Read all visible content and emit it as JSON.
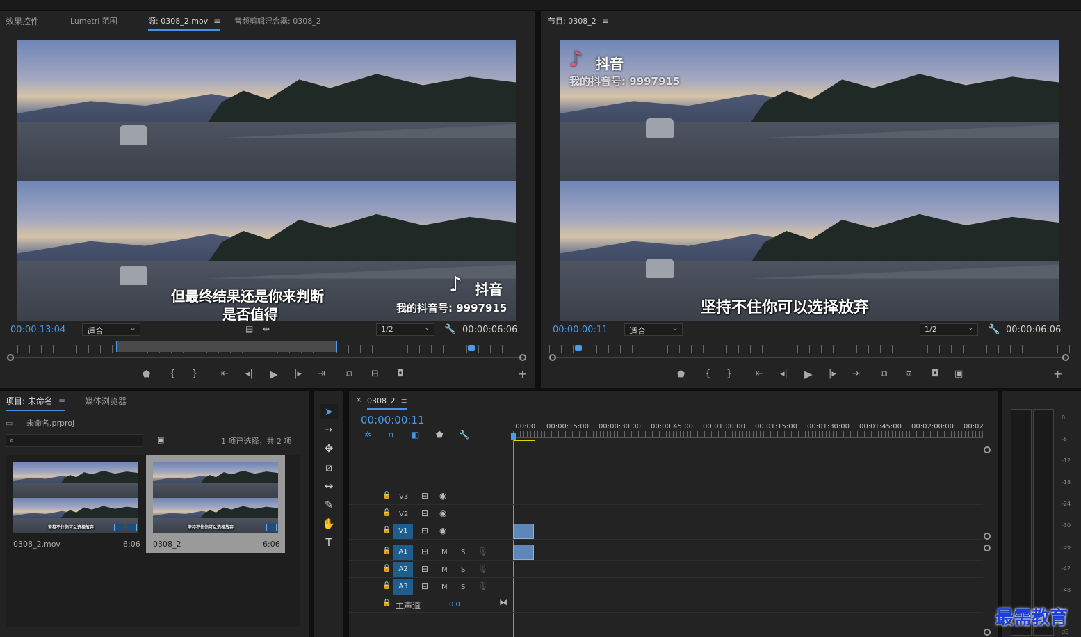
{
  "source_panel": {
    "tabs": [
      "效果控件",
      "Lumetri 范围",
      "源: 0308_2.mov",
      "音频剪辑混合器: 0308_2"
    ],
    "timecode": "00:00:13:04",
    "fit": "适合",
    "res": "1/2",
    "duration": "00:00:06:06",
    "subtitle_line1": "但最终结果还是你来判断",
    "subtitle_line2": "是否值得",
    "tiktok_name": "抖音",
    "tiktok_id": "我的抖音号: 9997915"
  },
  "program_panel": {
    "tab": "节目: 0308_2",
    "timecode": "00:00:00:11",
    "fit": "适合",
    "res": "1/2",
    "duration": "00:00:06:06",
    "tiktok_name": "抖音",
    "tiktok_id": "我的抖音号: 9997915",
    "subtitle": "坚持不住你可以选择放弃"
  },
  "project_panel": {
    "tabs": [
      "项目: 未命名",
      "媒体浏览器"
    ],
    "project_file": "未命名.prproj",
    "selection_info": "1 项已选择，共 2 项",
    "items": [
      {
        "name": "0308_2.mov",
        "duration": "6:06",
        "caption": "坚持不住你可以选择放弃"
      },
      {
        "name": "0308_2",
        "duration": "6:06",
        "caption": "坚持不住你可以选择放弃"
      }
    ]
  },
  "timeline": {
    "tab": "0308_2",
    "timecode": "00:00:00:11",
    "ruler": [
      ":00:00",
      "00:00:15:00",
      "00:00:30:00",
      "00:00:45:00",
      "00:01:00:00",
      "00:01:15:00",
      "00:01:30:00",
      "00:01:45:00",
      "00:02:00:00",
      "00:02"
    ],
    "video_tracks": [
      "V3",
      "V2",
      "V1"
    ],
    "audio_tracks": [
      "A1",
      "A2",
      "A3"
    ],
    "master_label": "主声道",
    "master_value": "0.0",
    "m": "M",
    "s": "S",
    "source_v": "V1",
    "source_a": "A1"
  },
  "meter": {
    "scale": [
      "0",
      "-6",
      "-12",
      "-18",
      "-24",
      "-30",
      "-36",
      "-42",
      "-48",
      "dB"
    ]
  },
  "watermark": "最需教育",
  "colors": {
    "accent": "#4a9be8",
    "panel": "#232323",
    "track_target": "#1f5d8c",
    "clip": "#5f86b8"
  }
}
